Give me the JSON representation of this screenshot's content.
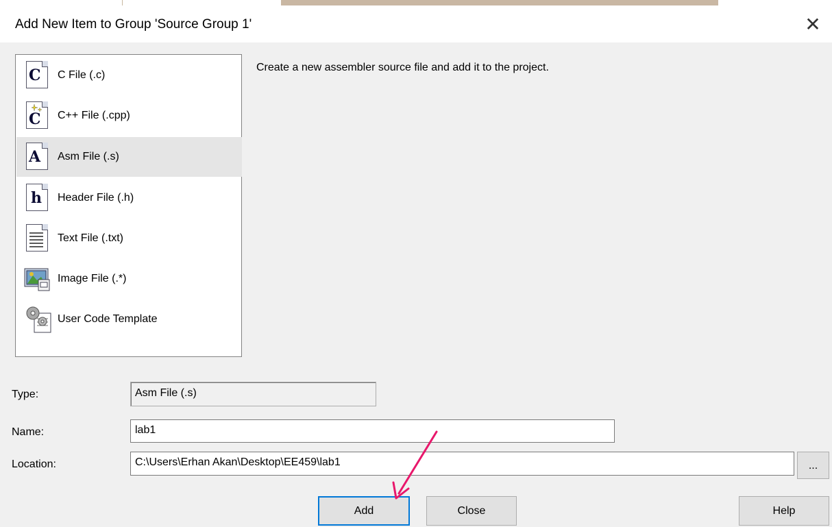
{
  "dialog": {
    "title": "Add New Item to Group 'Source Group 1'",
    "close_symbol": "✕"
  },
  "file_types": [
    {
      "label": "C File (.c)",
      "icon": "c-file-icon",
      "glyph": "C"
    },
    {
      "label": "C++ File (.cpp)",
      "icon": "cpp-file-icon",
      "glyph": "C"
    },
    {
      "label": "Asm File (.s)",
      "icon": "asm-file-icon",
      "glyph": "A",
      "selected": true
    },
    {
      "label": "Header File (.h)",
      "icon": "header-file-icon",
      "glyph": "h"
    },
    {
      "label": "Text File (.txt)",
      "icon": "text-file-icon",
      "glyph": ""
    },
    {
      "label": "Image File (.*)",
      "icon": "image-file-icon",
      "glyph": ""
    },
    {
      "label": "User Code Template",
      "icon": "user-code-template-icon",
      "glyph": ""
    }
  ],
  "description": "Create a new assembler source file and add it to the project.",
  "form": {
    "type_label": "Type:",
    "type_value": "Asm File (.s)",
    "name_label": "Name:",
    "name_value": "lab1",
    "location_label": "Location:",
    "location_value": "C:\\Users\\Erhan Akan\\Desktop\\EE459\\lab1",
    "browse_label": "..."
  },
  "buttons": {
    "add": "Add",
    "close": "Close",
    "help": "Help"
  },
  "colors": {
    "annotation_arrow": "#e8176b",
    "selection": "#e5e5e5",
    "focus_border": "#0078d7"
  }
}
